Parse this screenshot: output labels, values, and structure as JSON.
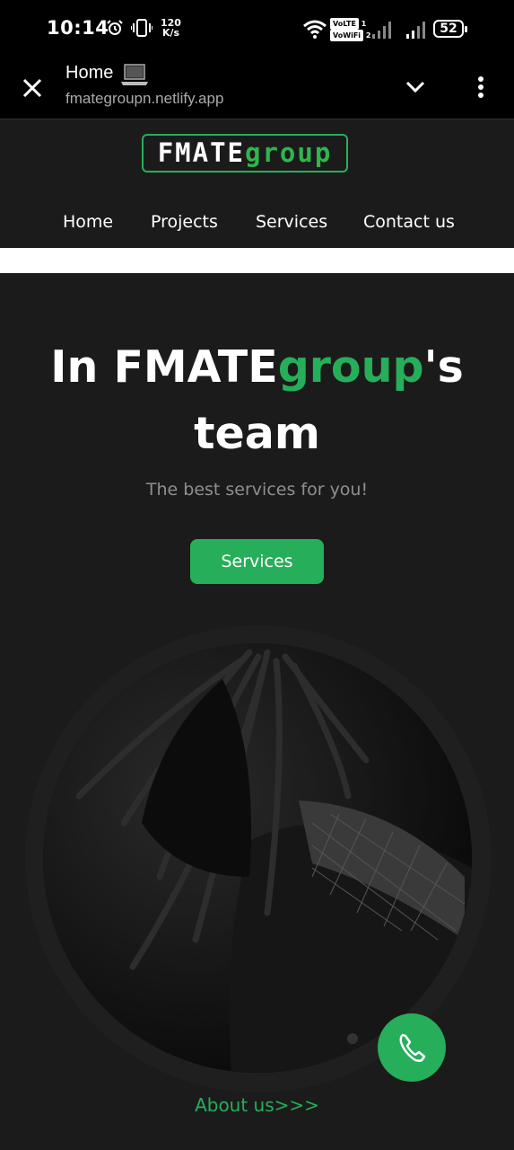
{
  "status_bar": {
    "time": "10:14",
    "net_speed_top": "120",
    "net_speed_bottom": "K/s",
    "volte1": "VoLTE",
    "volte1_slot": "1",
    "vowifi2": "VoWiFi",
    "vowifi2_slot": "2",
    "battery": "52"
  },
  "browser": {
    "title": "Home",
    "url": "fmategroupn.netlify.app"
  },
  "site": {
    "logo_part1": "FMATE",
    "logo_part2": "group",
    "nav": [
      "Home",
      "Projects",
      "Services",
      "Contact us"
    ],
    "hero_title_1": "In FMATE",
    "hero_title_green": "group",
    "hero_title_2": "'s",
    "hero_title_3": "team",
    "hero_subtitle": "The best services for you!",
    "hero_button": "Services",
    "about_link": "About us>>>"
  },
  "colors": {
    "accent": "#27ae5a",
    "background": "#1b1b1b"
  }
}
